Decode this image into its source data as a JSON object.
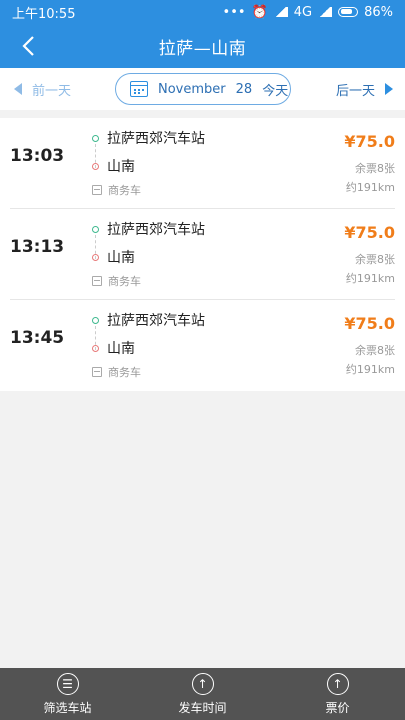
{
  "status_bar": {
    "time": "上午10:55",
    "network": "4G",
    "battery": "86%",
    "icons": [
      "dots-icon",
      "alarm-icon",
      "signal-icon",
      "battery-icon"
    ]
  },
  "nav": {
    "title": "拉萨—山南",
    "back_icon": "chevron-left-icon"
  },
  "date_bar": {
    "prev_label": "前一天",
    "next_label": "后一天",
    "month": "November",
    "day": "28",
    "today": "今天",
    "calendar_icon": "calendar-icon"
  },
  "trips": [
    {
      "time": "13:03",
      "from": "拉萨西郊汽车站",
      "to": "山南",
      "bus_type": "商务车",
      "price": "¥75.0",
      "seats": "余票8张",
      "distance": "约191km"
    },
    {
      "time": "13:13",
      "from": "拉萨西郊汽车站",
      "to": "山南",
      "bus_type": "商务车",
      "price": "¥75.0",
      "seats": "余票8张",
      "distance": "约191km"
    },
    {
      "time": "13:45",
      "from": "拉萨西郊汽车站",
      "to": "山南",
      "bus_type": "商务车",
      "price": "¥75.0",
      "seats": "余票8张",
      "distance": "约191km"
    }
  ],
  "bottom_tabs": [
    {
      "label": "筛选车站",
      "icon": "filter-icon"
    },
    {
      "label": "发车时间",
      "icon": "arrow-up-icon"
    },
    {
      "label": "票价",
      "icon": "arrow-up-icon"
    }
  ],
  "colors": {
    "primary": "#2d8fe0",
    "price": "#f07d1a",
    "bottom_bar": "#535353"
  }
}
